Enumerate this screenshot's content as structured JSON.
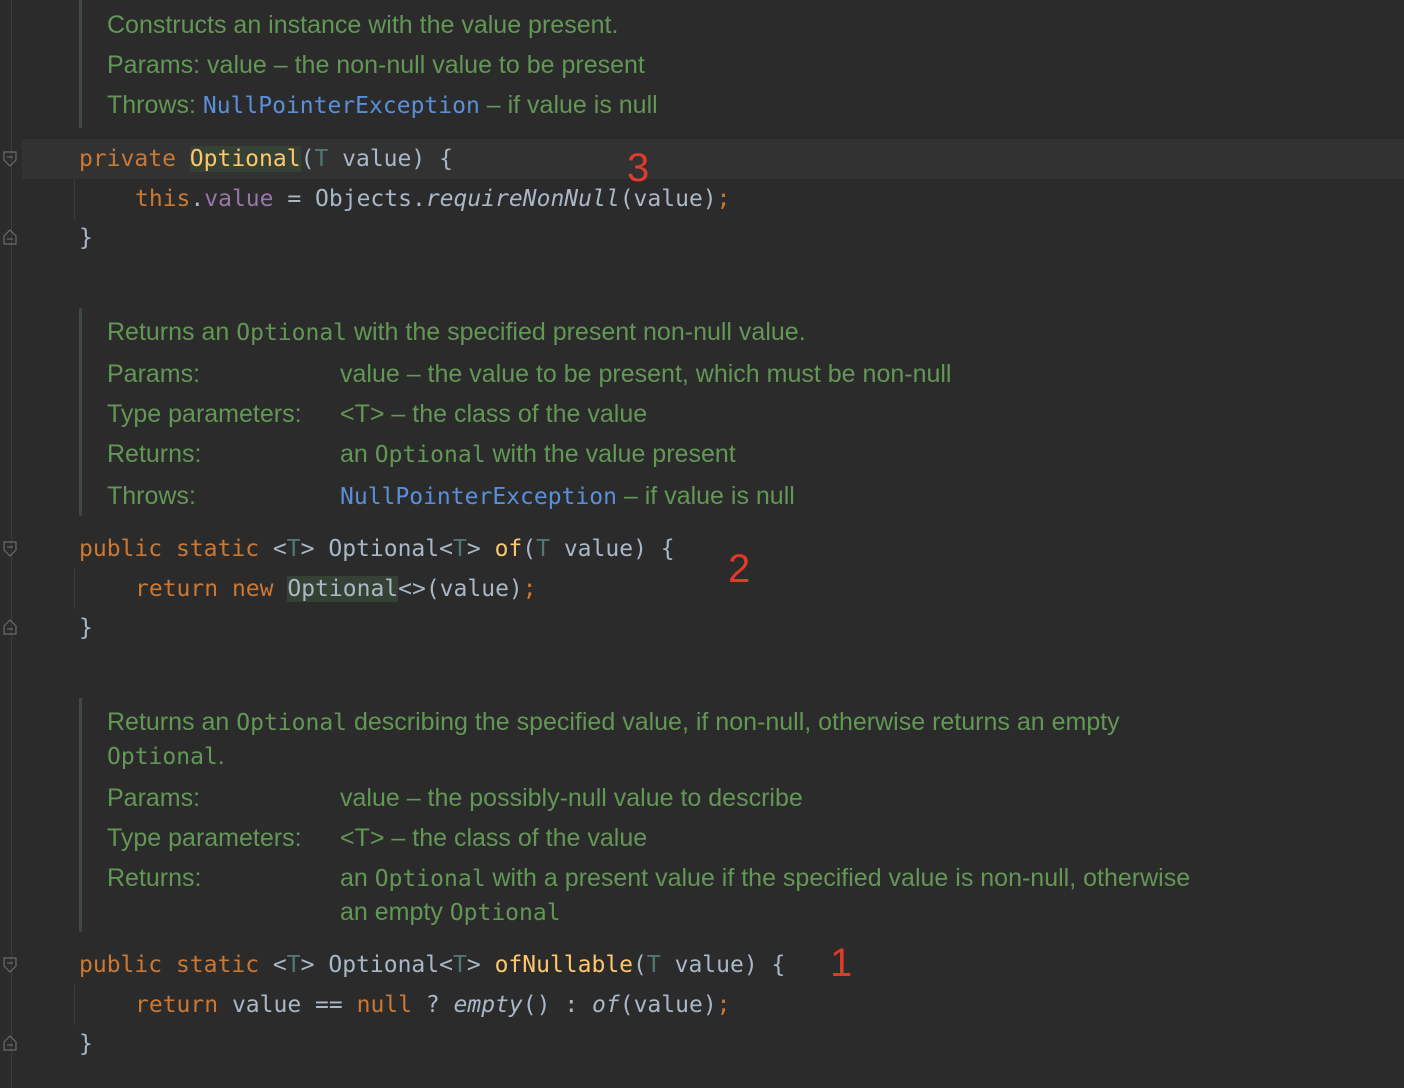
{
  "doc1": {
    "summary": "Constructs an instance with the value present.",
    "params_label": "Params:",
    "params_value": "value – the non-null value to be present",
    "throws_label": "Throws:",
    "throws_link": "NullPointerException",
    "throws_text": " – if value is null"
  },
  "code1": {
    "kw_private": "private",
    "name": "Optional",
    "open": "(",
    "type_T": "T",
    "param_rest": " value) {",
    "body_this": "this",
    "body_dot": ".",
    "body_field": "value",
    "body_assign": " = Objects.",
    "body_method": "requireNonNull",
    "body_args": "(value)",
    "semicolon": ";",
    "close_brace": "}"
  },
  "doc2": {
    "summary_pre": "Returns an ",
    "summary_code": "Optional",
    "summary_post": " with the specified present non-null value.",
    "params_label": "Params:",
    "params_value": "value – the value to be present, which must be non-null",
    "type_params_label": "Type parameters:",
    "type_params_value": "<T> – the class of the value",
    "returns_label": "Returns:",
    "returns_pre": "an ",
    "returns_code": "Optional",
    "returns_post": " with the value present",
    "throws_label": "Throws:",
    "throws_link": "NullPointerException",
    "throws_text": " – if value is null"
  },
  "code2": {
    "kw_public": "public",
    "kw_static": "static",
    "generic_open": "<",
    "type_T": "T",
    "generic_close": ">",
    "return_type": "Optional",
    "name": "of",
    "open": "(",
    "param_rest": " value) {",
    "kw_return": "return",
    "kw_new": "new",
    "new_type": "Optional",
    "diamond_args": "<>(value)",
    "semicolon": ";",
    "close_brace": "}"
  },
  "doc3": {
    "summary_pre": "Returns an ",
    "summary_code": "Optional",
    "summary_post": " describing the specified value, if non-null, otherwise returns an empty",
    "summary_line2_code": "Optional",
    "summary_line2_post": ".",
    "params_label": "Params:",
    "params_value": "value – the possibly-null value to describe",
    "type_params_label": "Type parameters:",
    "type_params_value": "<T> – the class of the value",
    "returns_label": "Returns:",
    "returns_pre": "an ",
    "returns_code": "Optional",
    "returns_post": " with a present value if the specified value is non-null, otherwise",
    "returns_line2_pre": "an empty ",
    "returns_line2_code": "Optional"
  },
  "code3": {
    "kw_public": "public",
    "kw_static": "static",
    "generic_open": "<",
    "type_T": "T",
    "generic_close": ">",
    "return_type": "Optional",
    "name": "ofNullable",
    "open": "(",
    "param_rest": " value) {",
    "kw_return": "return",
    "expr_value": " value ",
    "op_eq": "==",
    "kw_null": "null",
    "ternary_q": " ? ",
    "empty_call": "empty",
    "empty_parens": "()",
    "ternary_colon": " : ",
    "of_call": "of",
    "of_args": "(value)",
    "semicolon": ";",
    "close_brace": "}"
  },
  "annotations": {
    "num_3": "3",
    "num_2": "2",
    "num_1": "1",
    "color": "#e03a2a"
  },
  "colors": {
    "background": "#2b2b2b",
    "keyword": "#cc7832",
    "function": "#ffc66d",
    "doc_text": "#629755",
    "doc_link": "#5a8fd8",
    "field": "#9876aa",
    "type_param": "#507874",
    "default_text": "#a9b7c6"
  }
}
